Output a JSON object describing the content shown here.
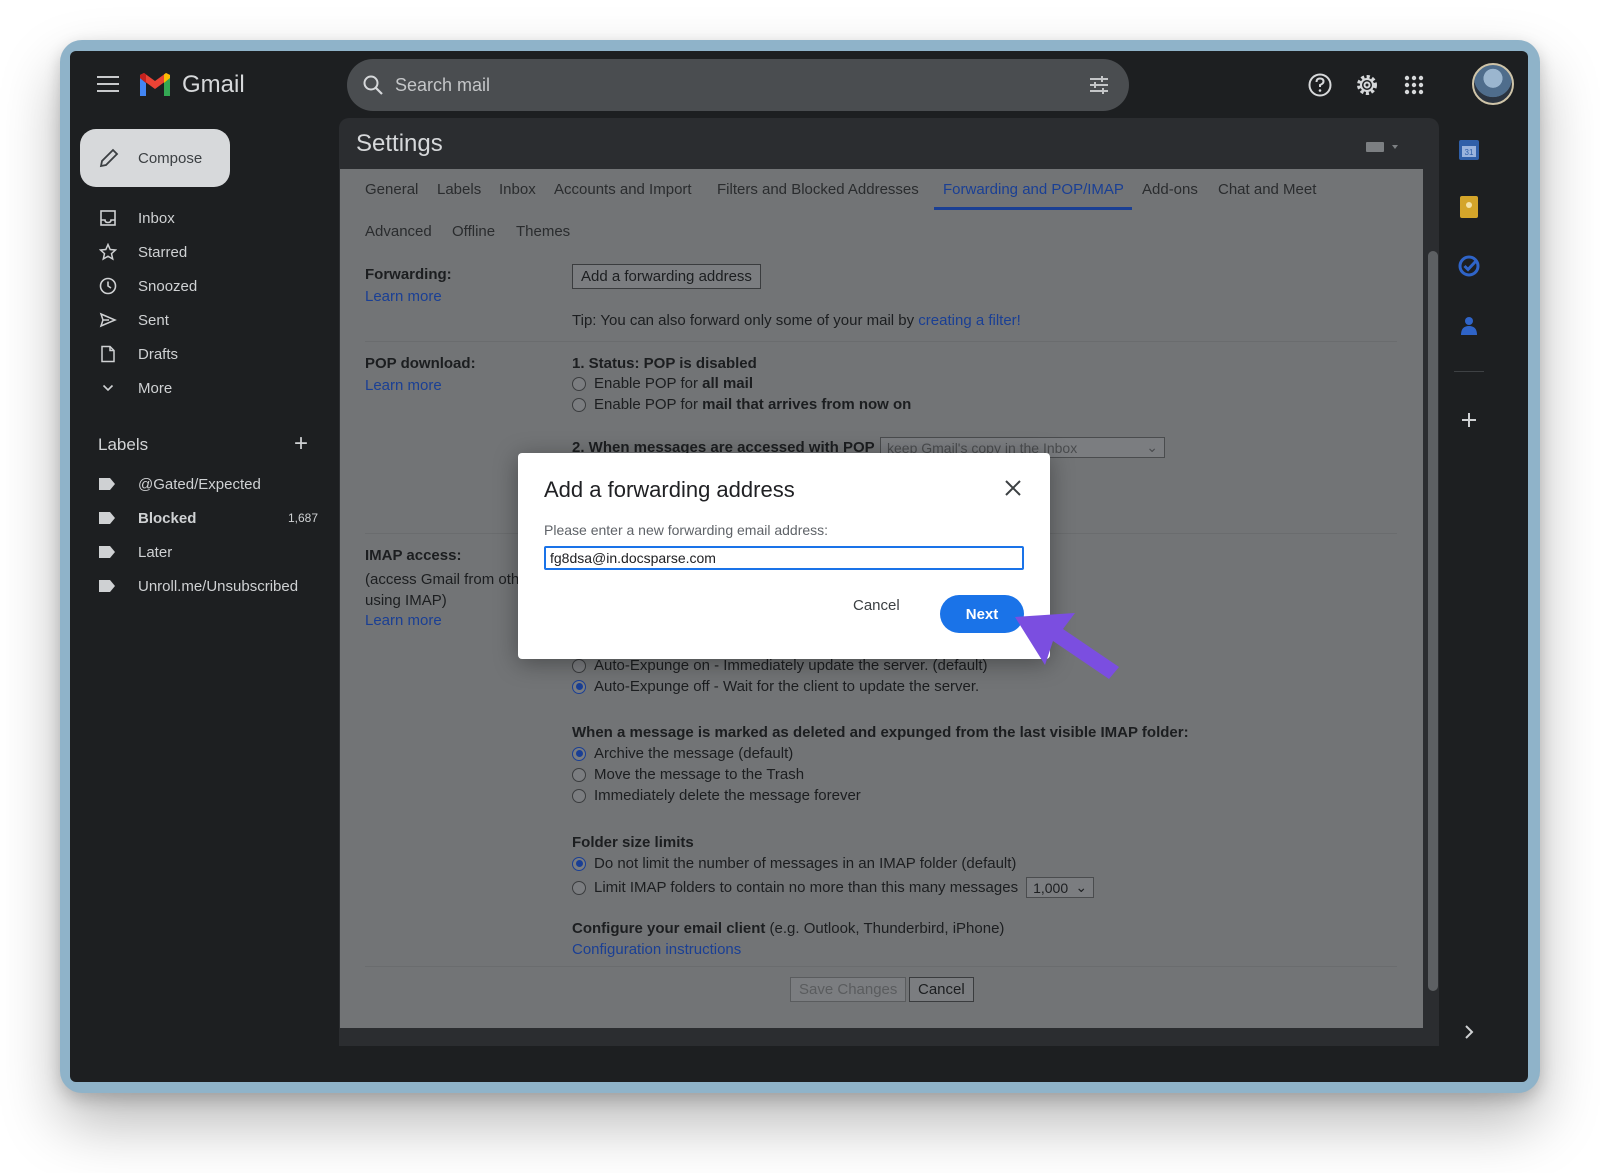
{
  "header": {
    "app_name": "Gmail",
    "search_placeholder": "Search mail"
  },
  "nav": {
    "compose_label": "Compose",
    "items": [
      {
        "label": "Inbox",
        "icon": "inbox-icon"
      },
      {
        "label": "Starred",
        "icon": "star-icon"
      },
      {
        "label": "Snoozed",
        "icon": "clock-icon"
      },
      {
        "label": "Sent",
        "icon": "send-icon"
      },
      {
        "label": "Drafts",
        "icon": "draft-icon"
      },
      {
        "label": "More",
        "icon": "chevron-down-icon"
      }
    ],
    "labels_heading": "Labels",
    "labels": [
      {
        "label": "@Gated/Expected",
        "count": ""
      },
      {
        "label": "Blocked",
        "count": "1,687"
      },
      {
        "label": "Later",
        "count": ""
      },
      {
        "label": "Unroll.me/Unsubscribed",
        "count": ""
      }
    ]
  },
  "settings": {
    "title": "Settings",
    "tabs": [
      "General",
      "Labels",
      "Inbox",
      "Accounts and Import",
      "Filters and Blocked Addresses",
      "Forwarding and POP/IMAP",
      "Add-ons",
      "Chat and Meet",
      "Advanced",
      "Offline",
      "Themes"
    ],
    "active_tab": "Forwarding and POP/IMAP",
    "forwarding": {
      "label": "Forwarding:",
      "learn_more": "Learn more",
      "add_button": "Add a forwarding address",
      "tip_prefix": "Tip: You can also forward only some of your mail by ",
      "tip_link": "creating a filter!"
    },
    "pop": {
      "label": "POP download:",
      "learn_more": "Learn more",
      "status": "1. Status: POP is disabled",
      "option1_prefix": "Enable POP for ",
      "option1_bold": "all mail",
      "option2_prefix": "Enable POP for ",
      "option2_bold": "mail that arrives from now on",
      "step2": "2. When messages are accessed with POP",
      "step2_select": "keep Gmail's copy in the Inbox"
    },
    "imap": {
      "label": "IMAP access:",
      "sub1": "(access Gmail from other c",
      "sub2": "using IMAP)",
      "learn_more": "Learn more",
      "expunge_on": "Auto-Expunge on - Immediately update the server. (default)",
      "expunge_off": "Auto-Expunge off - Wait for the client to update the server.",
      "deleted_heading": "When a message is marked as deleted and expunged from the last visible IMAP folder:",
      "deleted_options": [
        "Archive the message (default)",
        "Move the message to the Trash",
        "Immediately delete the message forever"
      ],
      "folder_heading": "Folder size limits",
      "folder_option1": "Do not limit the number of messages in an IMAP folder (default)",
      "folder_option2": "Limit IMAP folders to contain no more than this many messages",
      "folder_limit_value": "1,000",
      "configure_bold": "Configure your email client",
      "configure_rest": " (e.g. Outlook, Thunderbird, iPhone)",
      "config_link": "Configuration instructions"
    },
    "save_button": "Save Changes",
    "cancel_button": "Cancel"
  },
  "modal": {
    "title": "Add a forwarding address",
    "prompt": "Please enter a new forwarding email address:",
    "input_value": "fg8dsa@in.docsparse.com",
    "cancel": "Cancel",
    "next": "Next",
    "accent": "#1a73e8"
  },
  "pointer_color": "#7b4ee0"
}
